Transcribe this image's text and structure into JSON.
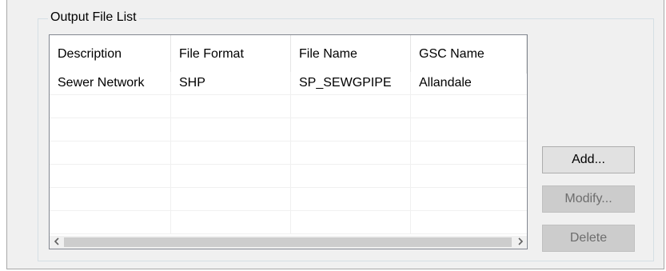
{
  "groupbox": {
    "title": "Output File List"
  },
  "list": {
    "columns": [
      "Description",
      "File Format",
      "File Name",
      "GSC Name"
    ],
    "rows": [
      [
        "Sewer Network",
        "SHP",
        "SP_SEWGPIPE",
        "Allandale"
      ],
      [
        "",
        "",
        "",
        ""
      ],
      [
        "",
        "",
        "",
        ""
      ],
      [
        "",
        "",
        "",
        ""
      ],
      [
        "",
        "",
        "",
        ""
      ],
      [
        "",
        "",
        "",
        ""
      ],
      [
        "",
        "",
        "",
        ""
      ]
    ]
  },
  "buttons": {
    "add": "Add...",
    "modify": "Modify...",
    "delete": "Delete"
  },
  "icons": {
    "scroll_left": "chevron-left-icon",
    "scroll_right": "chevron-right-icon"
  },
  "colors": {
    "panel_bg": "#f0f0f0",
    "disabled_button_bg": "#cccccc",
    "scroll_thumb": "#cdcdcd"
  }
}
